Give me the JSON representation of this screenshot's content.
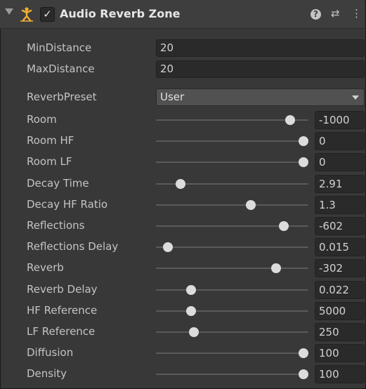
{
  "header": {
    "title": "Audio Reverb Zone",
    "enabled": true,
    "enabled_mark": "✓",
    "help_glyph": "?",
    "presets_glyph": "⇄",
    "menu_glyph": "⋮",
    "icons": [
      "foldout-arrow-icon",
      "audio-reverb-zone-icon",
      "checkbox-icon",
      "help-icon",
      "presets-icon",
      "context-menu-icon"
    ]
  },
  "min_distance": {
    "label": "MinDistance",
    "value": "20"
  },
  "max_distance": {
    "label": "MaxDistance",
    "value": "20"
  },
  "reverb_preset": {
    "label": "ReverbPreset",
    "value": "User"
  },
  "sliders": [
    {
      "label": "Room",
      "value": "-1000",
      "level": 0.88
    },
    {
      "label": "Room HF",
      "value": "0",
      "level": 0.97
    },
    {
      "label": "Room LF",
      "value": "0",
      "level": 0.97
    },
    {
      "label": "Decay Time",
      "value": "2.91",
      "level": 0.16
    },
    {
      "label": "Decay HF Ratio",
      "value": "1.3",
      "level": 0.62
    },
    {
      "label": "Reflections",
      "value": "-602",
      "level": 0.84
    },
    {
      "label": "Reflections Delay",
      "value": "0.015",
      "level": 0.08
    },
    {
      "label": "Reverb",
      "value": "-302",
      "level": 0.79
    },
    {
      "label": "Reverb Delay",
      "value": "0.022",
      "level": 0.23
    },
    {
      "label": "HF Reference",
      "value": "5000",
      "level": 0.23
    },
    {
      "label": "LF Reference",
      "value": "250",
      "level": 0.25
    },
    {
      "label": "Diffusion",
      "value": "100",
      "level": 0.97
    },
    {
      "label": "Density",
      "value": "100",
      "level": 0.97
    }
  ]
}
